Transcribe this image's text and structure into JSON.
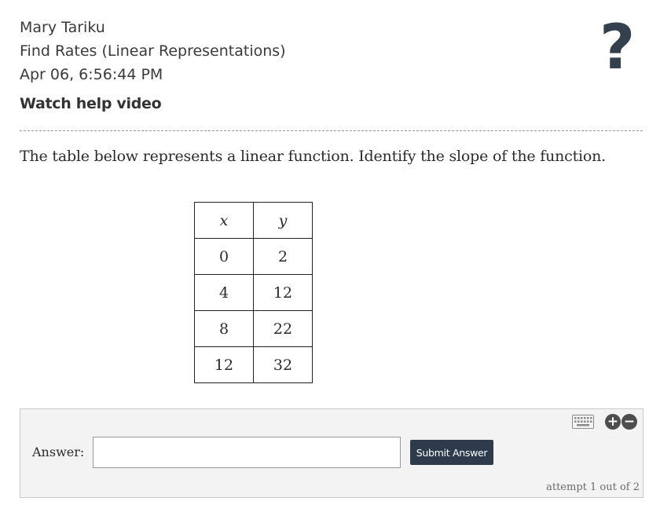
{
  "header": {
    "student_name": "Mary Tariku",
    "assignment": "Find Rates (Linear Representations)",
    "timestamp": "Apr 06, 6:56:44 PM",
    "help_video": "Watch help video",
    "help_icon": "?"
  },
  "question": {
    "text": "The table below represents a linear function. Identify the slope of the function."
  },
  "table": {
    "headers": [
      "x",
      "y"
    ],
    "rows": [
      [
        "0",
        "2"
      ],
      [
        "4",
        "12"
      ],
      [
        "8",
        "22"
      ],
      [
        "12",
        "32"
      ]
    ]
  },
  "answer": {
    "label": "Answer:",
    "value": "",
    "submit_label": "Submit Answer",
    "attempt_text": "attempt 1 out of 2",
    "plus_symbol": "+",
    "minus_symbol": "−"
  },
  "colors": {
    "accent": "#2e3b4c",
    "help_icon": "#34404d",
    "answer_bg": "#f3f3f4"
  },
  "icons": [
    "help-icon",
    "keyboard-icon",
    "plus-icon",
    "minus-icon"
  ]
}
